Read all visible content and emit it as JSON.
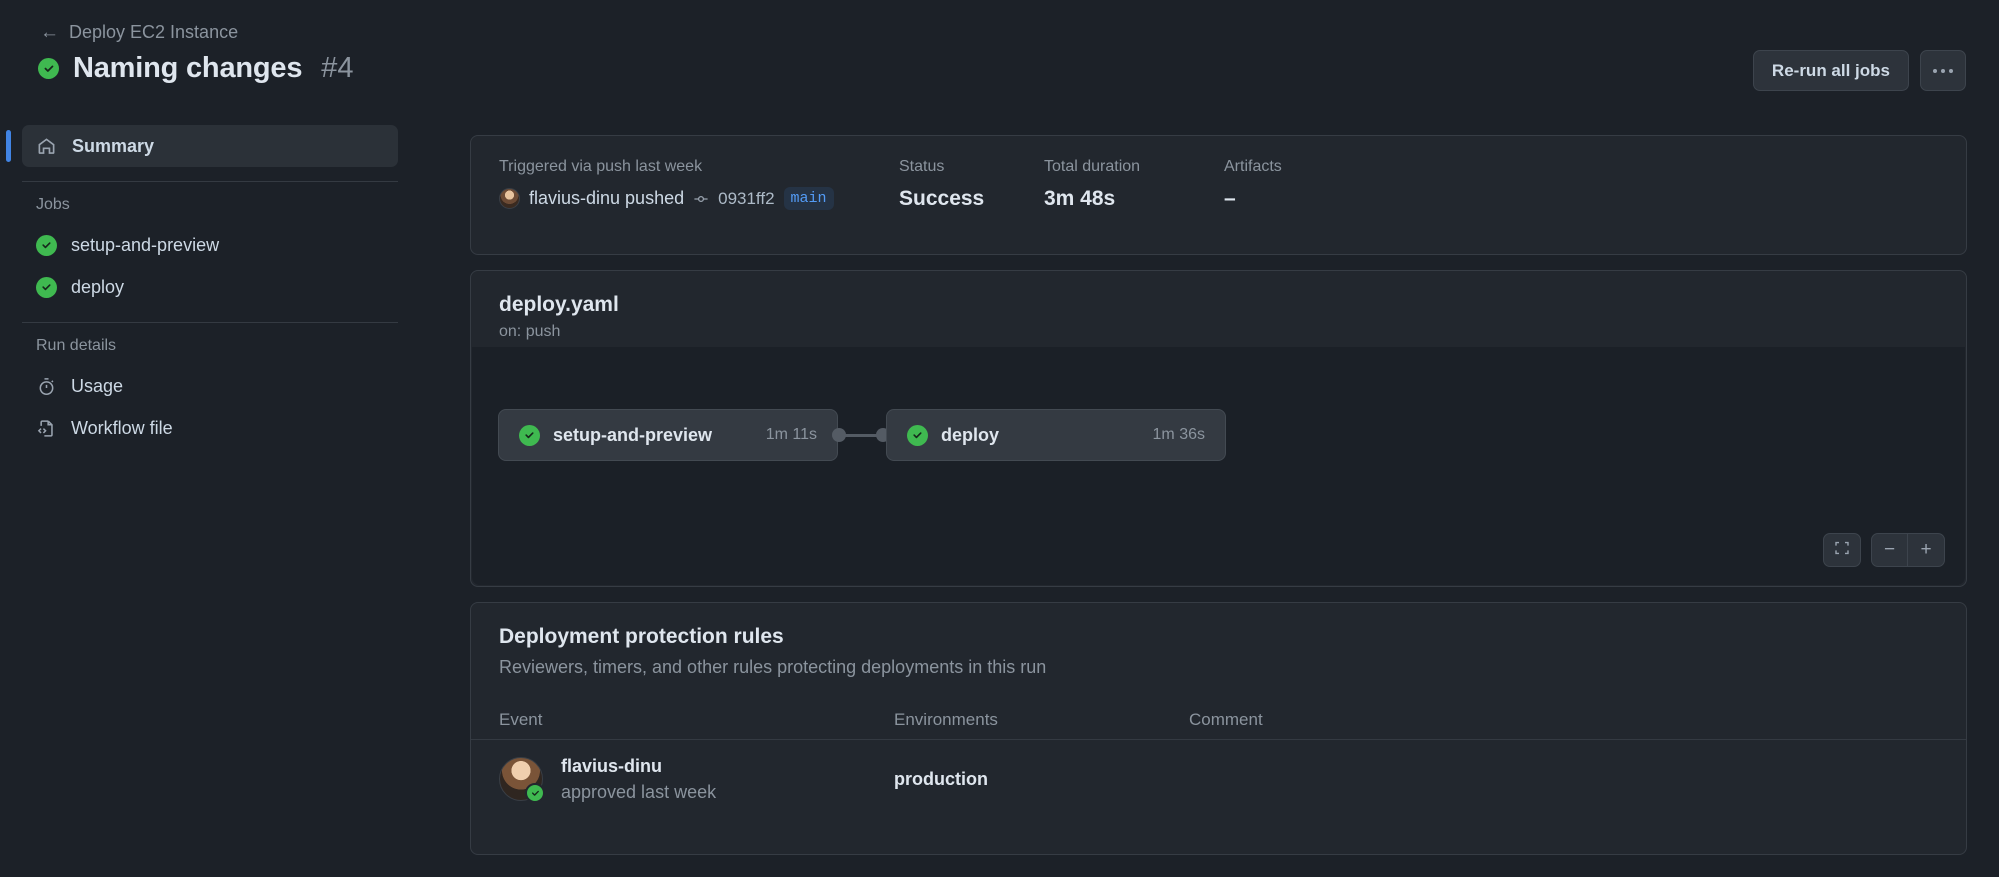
{
  "header": {
    "breadcrumb_back_icon": "arrow-left-icon",
    "breadcrumb_label": "Deploy EC2 Instance",
    "status_icon": "check-circle-icon",
    "title": "Naming changes",
    "run_number": "#4",
    "rerun_button": "Re-run all jobs",
    "more_button_icon": "kebab-horizontal-icon"
  },
  "sidebar": {
    "summary": {
      "label": "Summary",
      "icon": "home-icon"
    },
    "jobs_heading": "Jobs",
    "jobs": [
      {
        "label": "setup-and-preview",
        "icon": "check-circle-icon"
      },
      {
        "label": "deploy",
        "icon": "check-circle-icon"
      }
    ],
    "run_details_heading": "Run details",
    "run_details": [
      {
        "label": "Usage",
        "icon": "stopwatch-icon"
      },
      {
        "label": "Workflow file",
        "icon": "file-code-icon"
      }
    ]
  },
  "info": {
    "trigger_label": "Triggered via push last week",
    "pusher": "flavius-dinu pushed",
    "commit_icon": "commit-icon",
    "commit_sha": "0931ff2",
    "branch": "main",
    "status_label": "Status",
    "status_value": "Success",
    "duration_label": "Total duration",
    "duration_value": "3m 48s",
    "artifacts_label": "Artifacts",
    "artifacts_value": "–"
  },
  "graph": {
    "workflow_file": "deploy.yaml",
    "trigger": "on: push",
    "nodes": [
      {
        "name": "setup-and-preview",
        "duration": "1m 11s",
        "icon": "check-circle-icon"
      },
      {
        "name": "deploy",
        "duration": "1m 36s",
        "icon": "check-circle-icon"
      }
    ],
    "controls": {
      "fit_icon": "fit-screen-icon",
      "zoom_out": "−",
      "zoom_in": "+"
    }
  },
  "rules": {
    "title": "Deployment protection rules",
    "subtitle": "Reviewers, timers, and other rules protecting deployments in this run",
    "columns": [
      "Event",
      "Environments",
      "Comment"
    ],
    "rows": [
      {
        "reviewer": "flavius-dinu",
        "status": "approved last week",
        "badge_icon": "check-circle-icon",
        "environment": "production",
        "comment": ""
      }
    ]
  },
  "colors": {
    "page_bg": "#1c2128",
    "card_bg": "#22272e",
    "graph_bg": "#1b2027",
    "success_green": "#3fb950",
    "accent_blue": "#4184e4",
    "branch_blue": "#539bf5",
    "muted_text": "#8b949e"
  }
}
